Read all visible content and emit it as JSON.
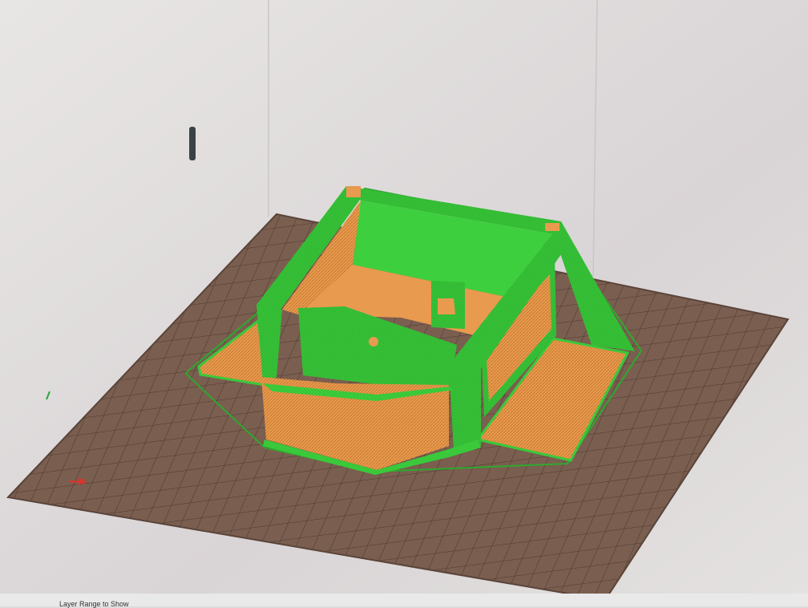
{
  "app": {
    "name": "Slicer 3D preview",
    "view": "layer preview"
  },
  "viewport": {
    "bed_color": "#7a5e4f",
    "grid_line_color": "#3f3029",
    "perimeter_color": "#39c93a",
    "infill_color": "#e89a4e",
    "background_color": "#dcdcdc",
    "axis_x_color": "#e0322b",
    "axis_y_color": "#2aa53a"
  },
  "slider": {
    "icon": "layer-slider-handle-icon"
  },
  "bottom_bar": {
    "layer_range_label": "Layer Range to Show"
  }
}
